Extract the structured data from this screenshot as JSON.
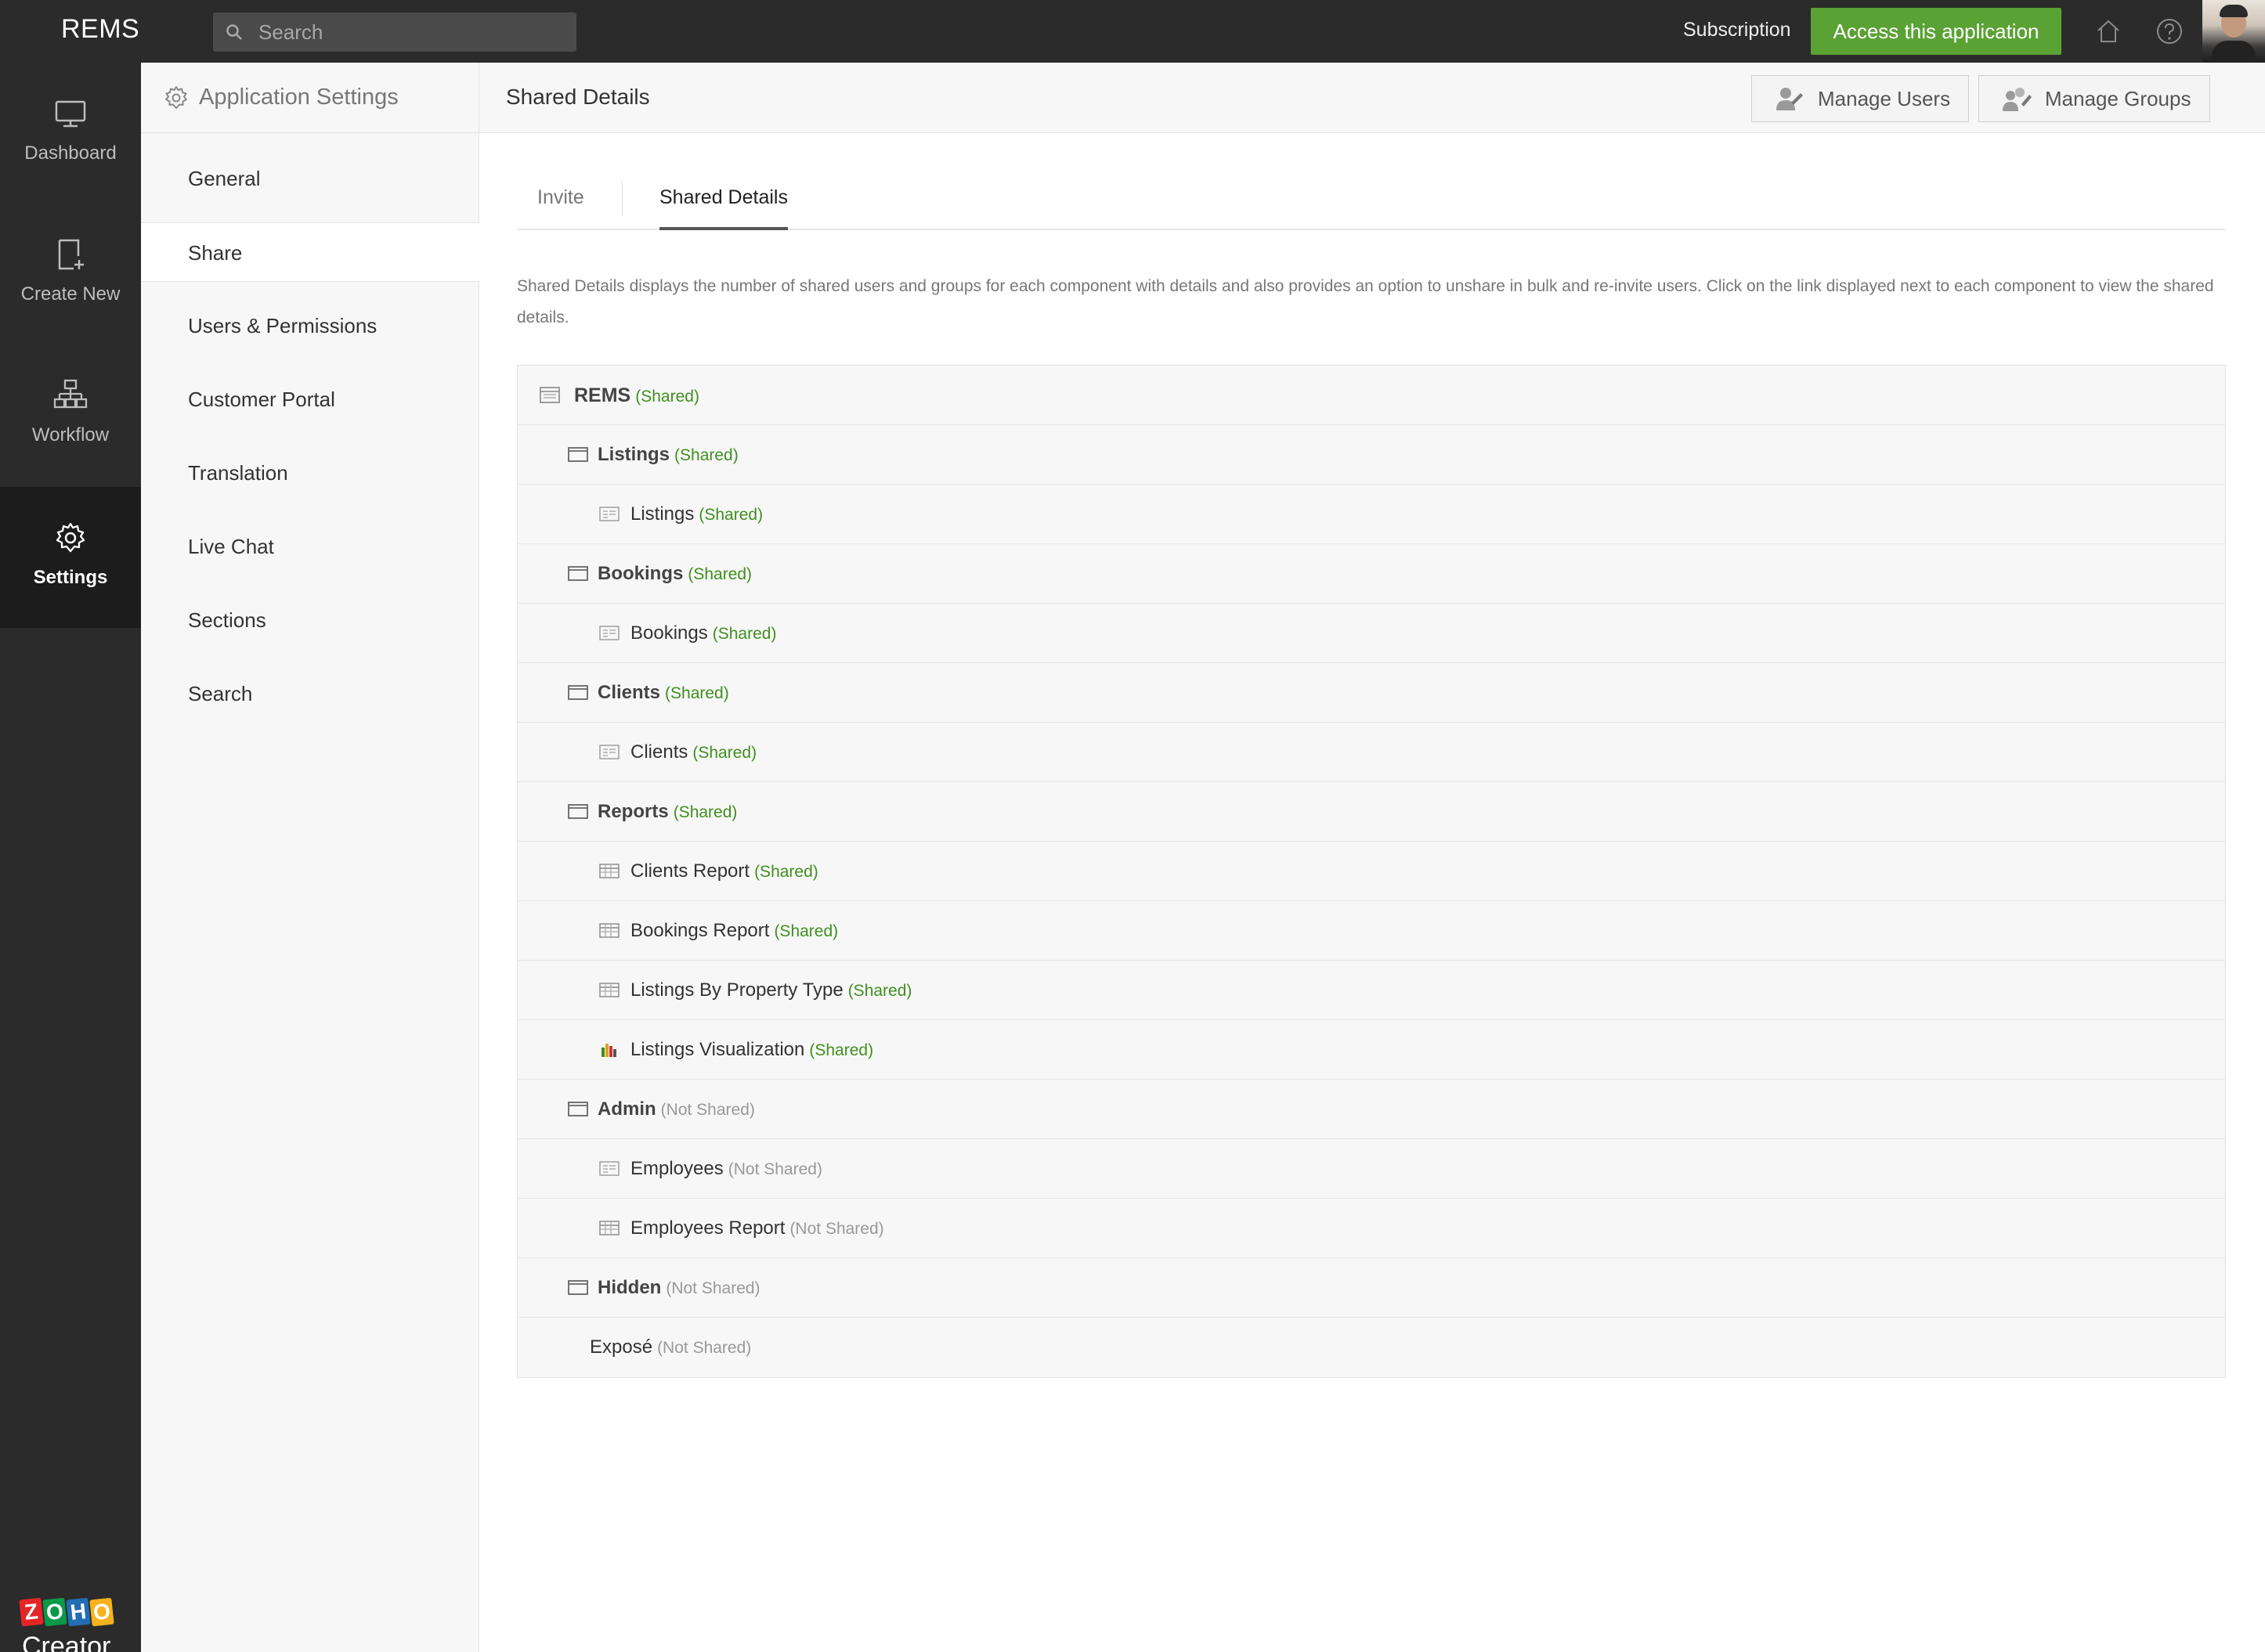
{
  "topbar": {
    "app_name": "REMS",
    "search_placeholder": "Search",
    "subscription": "Subscription",
    "access_button": "Access this application",
    "icons": [
      "home-icon",
      "help-icon"
    ],
    "bg_color": "#2b2b2b",
    "accent_color": "#5aa234"
  },
  "leftnav": {
    "items": [
      {
        "label": "Dashboard",
        "icon": "monitor-icon"
      },
      {
        "label": "Create New",
        "icon": "create-new-icon"
      },
      {
        "label": "Workflow",
        "icon": "workflow-icon"
      },
      {
        "label": "Settings",
        "icon": "gear-icon",
        "active": true
      }
    ],
    "brand_letters": [
      "Z",
      "O",
      "H",
      "O"
    ],
    "brand_name": "Creator"
  },
  "settings_sidebar": {
    "title": "Application Settings",
    "items": [
      {
        "label": "General"
      },
      {
        "label": "Share",
        "active": true
      },
      {
        "label": "Users & Permissions"
      },
      {
        "label": "Customer Portal"
      },
      {
        "label": "Translation"
      },
      {
        "label": "Live Chat"
      },
      {
        "label": "Sections"
      },
      {
        "label": "Search"
      }
    ]
  },
  "main": {
    "title": "Shared Details",
    "manage_users": "Manage Users",
    "manage_groups": "Manage Groups",
    "tabs": [
      {
        "label": "Invite"
      },
      {
        "label": "Shared Details",
        "active": true
      }
    ],
    "description": "Shared Details displays the number of shared users and groups for each component with details and also provides an option to unshare in bulk and re-invite users. Click on the link displayed next to each component to view the shared details.",
    "tree": [
      {
        "label": "REMS",
        "status": "(Shared)",
        "level": 0,
        "icon": "app-icon"
      },
      {
        "label": "Listings",
        "status": "(Shared)",
        "level": 1,
        "icon": "section-icon"
      },
      {
        "label": "Listings",
        "status": "(Shared)",
        "level": 2,
        "icon": "form-icon"
      },
      {
        "label": "Bookings",
        "status": "(Shared)",
        "level": 1,
        "icon": "section-icon"
      },
      {
        "label": "Bookings",
        "status": "(Shared)",
        "level": 2,
        "icon": "form-icon"
      },
      {
        "label": "Clients",
        "status": "(Shared)",
        "level": 1,
        "icon": "section-icon"
      },
      {
        "label": "Clients",
        "status": "(Shared)",
        "level": 2,
        "icon": "form-icon"
      },
      {
        "label": "Reports",
        "status": "(Shared)",
        "level": 1,
        "icon": "section-icon"
      },
      {
        "label": "Clients Report",
        "status": "(Shared)",
        "level": 2,
        "icon": "report-icon"
      },
      {
        "label": "Bookings Report",
        "status": "(Shared)",
        "level": 2,
        "icon": "report-icon"
      },
      {
        "label": "Listings By Property Type",
        "status": "(Shared)",
        "level": 2,
        "icon": "report-icon"
      },
      {
        "label": "Listings Visualization",
        "status": "(Shared)",
        "level": 2,
        "icon": "chart-icon"
      },
      {
        "label": "Admin",
        "status": "(Not Shared)",
        "level": 1,
        "icon": "section-icon"
      },
      {
        "label": "Employees",
        "status": "(Not Shared)",
        "level": 2,
        "icon": "form-icon"
      },
      {
        "label": "Employees Report",
        "status": "(Not Shared)",
        "level": 2,
        "icon": "report-icon"
      },
      {
        "label": "Hidden",
        "status": "(Not Shared)",
        "level": 1,
        "icon": "section-icon"
      },
      {
        "label": "Exposé",
        "status": "(Not Shared)",
        "level": 2,
        "icon": "none"
      }
    ],
    "status_colors": {
      "shared": "#3f8f1e",
      "not_shared": "#999999"
    }
  }
}
